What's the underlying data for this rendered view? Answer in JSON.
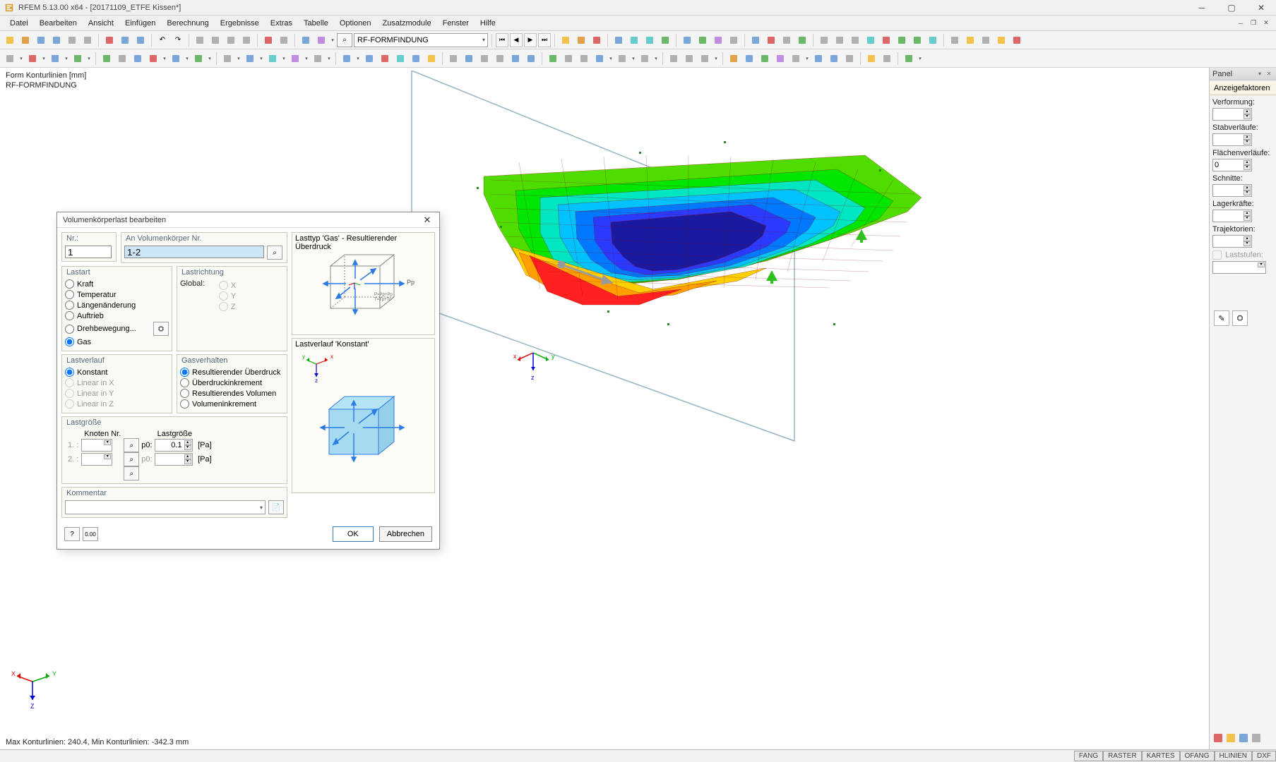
{
  "app": {
    "title": "RFEM 5.13.00 x64 - [20171109_ETFE Kissen*]"
  },
  "menu": [
    "Datei",
    "Bearbeiten",
    "Ansicht",
    "Einfügen",
    "Berechnung",
    "Ergebnisse",
    "Extras",
    "Tabelle",
    "Optionen",
    "Zusatzmodule",
    "Fenster",
    "Hilfe"
  ],
  "toolbar1": {
    "module": "RF-FORMFINDUNG"
  },
  "viewport": {
    "line1": "Form Konturlinien [mm]",
    "line2": "RF-FORMFINDUNG",
    "footer": "Max Konturlinien: 240.4, Min Konturlinien: -342.3 mm"
  },
  "panel": {
    "title": "Panel",
    "section_header": "Anzeigefaktoren",
    "labels": {
      "verformung": "Verformung:",
      "stabverlaufe": "Stabverläufe:",
      "flachenverlaufe": "Flächenverläufe:",
      "schnitte": "Schnitte:",
      "lagerkrafte": "Lagerkräfte:",
      "trajektorien": "Trajektorien:",
      "laststufen": "Laststufen:"
    },
    "flachen_value": "0"
  },
  "status_tabs": [
    "FANG",
    "RASTER",
    "KARTES",
    "OFANG",
    "HLINIEN",
    "DXF"
  ],
  "dialog": {
    "title": "Volumenkörperlast bearbeiten",
    "nr_label": "Nr.:",
    "nr_value": "1",
    "an_label": "An Volumenkörper Nr.",
    "an_value": "1-2",
    "groups": {
      "lastart": "Lastart",
      "lastrichtung": "Lastrichtung",
      "lastverlauf": "Lastverlauf",
      "gasverhalten": "Gasverhalten",
      "lastgroesse": "Lastgröße",
      "kommentar": "Kommentar"
    },
    "lastart_opts": [
      "Kraft",
      "Temperatur",
      "Längenänderung",
      "Auftrieb",
      "Drehbewegung...",
      "Gas"
    ],
    "lastart_sel": "Gas",
    "lastrichtung_label": "Global:",
    "lastrichtung_opts": [
      "X",
      "Y",
      "Z"
    ],
    "lastverlauf_opts": [
      "Konstant",
      "Linear in X",
      "Linear in Y",
      "Linear in Z"
    ],
    "lastverlauf_sel": "Konstant",
    "gas_opts": [
      "Resultierender Überdruck",
      "Überdruckinkrement",
      "Resultierendes Volumen",
      "Volumeninkrement"
    ],
    "gas_sel": "Resultierender Überdruck",
    "lastgroesse": {
      "knoten_header": "Knoten Nr.",
      "wert_header": "Lastgröße",
      "row1_label": "1. :",
      "row2_label": "2. :",
      "p0_label": "p0:",
      "p0_value": "0.1",
      "unit": "[Pa]"
    },
    "preview1_title": "Lasttyp 'Gas' - Resultierender Überdruck",
    "preview2_title": "Lastverlauf 'Konstant'",
    "axis_labels": {
      "x": "x",
      "y": "y",
      "z": "z",
      "pp": "Pp"
    },
    "ok": "OK",
    "cancel": "Abbrechen"
  }
}
